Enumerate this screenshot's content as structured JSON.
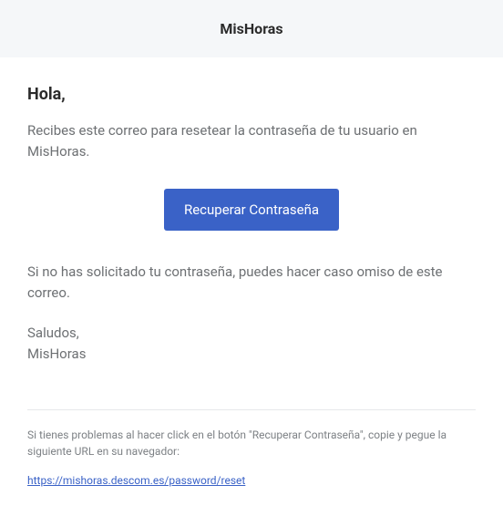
{
  "header": {
    "brand": "MisHoras"
  },
  "content": {
    "greeting": "Hola,",
    "intro": "Recibes este correo para resetear la contraseña de tu usuario en MisHoras.",
    "button_label": "Recuperar Contraseña",
    "ignore_notice": "Si no has solicitado tu contraseña, puedes hacer caso omiso de este correo.",
    "closing_salutation": "Saludos,",
    "closing_name": "MisHoras"
  },
  "footer": {
    "trouble_text": "Si tienes problemas al hacer click en el botón \"Recuperar Contraseña\", copie y pegue la siguiente URL en su navegador:",
    "reset_url": "https://mishoras.descom.es/password/reset"
  }
}
